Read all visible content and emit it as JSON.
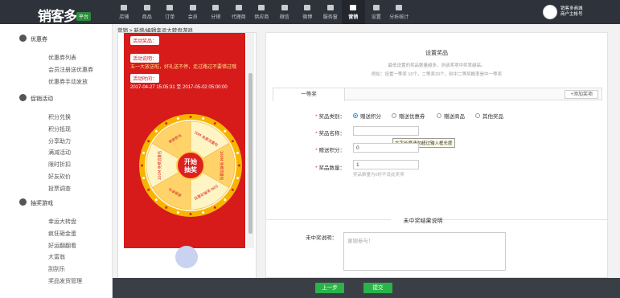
{
  "app": {
    "logo_text": "销客多",
    "logo_badge": "平台"
  },
  "nav": {
    "items": [
      {
        "label": "店铺",
        "icon": "store-icon"
      },
      {
        "label": "商品",
        "icon": "goods-icon"
      },
      {
        "label": "订单",
        "icon": "order-icon"
      },
      {
        "label": "会员",
        "icon": "member-icon"
      },
      {
        "label": "分销",
        "icon": "distribution-icon"
      },
      {
        "label": "代理商",
        "icon": "agent-icon"
      },
      {
        "label": "供应商",
        "icon": "supplier-icon"
      },
      {
        "label": "微信",
        "icon": "wechat-icon"
      },
      {
        "label": "微博",
        "icon": "weibo-icon"
      },
      {
        "label": "服务窗",
        "icon": "service-window-icon"
      },
      {
        "label": "营销",
        "icon": "marketing-icon"
      },
      {
        "label": "设置",
        "icon": "settings-icon"
      },
      {
        "label": "分析统计",
        "icon": "analytics-icon"
      }
    ],
    "active": "营销"
  },
  "user": {
    "line1": "销客多商城",
    "line2": "商户主帐号"
  },
  "sidebar": {
    "groups": [
      {
        "title": "优惠券",
        "items": [
          "优惠券列表",
          "会员注册送优惠券",
          "优惠券手动发放"
        ]
      },
      {
        "title": "促销活动",
        "items": [
          "积分兑换",
          "积分抵现",
          "分享助力",
          "满减活动",
          "限时折扣",
          "好友砍价",
          "投票调查"
        ]
      },
      {
        "title": "抽奖游戏",
        "items": [
          "幸运大转盘",
          "疯狂砸金蛋",
          "好运翻翻看",
          "大富翁",
          "刮刮乐",
          "奖品发货管理"
        ]
      }
    ]
  },
  "breadcrumb": "营销 > 新增/编辑幸运大转盘游戏",
  "preview": {
    "prize_tag": "活动奖品：",
    "desc_tag": "活动说明：",
    "desc_text": "五一大放送啦，好礼送不停，走过路过不要错过哦",
    "time_tag": "活动时间：",
    "time_text": "2017-04-27 15:05:31 至 2017-05-02 05:00:00",
    "wheel_center_top": "开始",
    "wheel_center_bottom": "抽奖",
    "wheel_segments": [
      "30M 免费流量包",
      "100M 免费流量包",
      "50M 免费流量包",
      "谢谢参与",
      "100M 免费流量包",
      "谢谢参与"
    ]
  },
  "settings": {
    "title": "设置奖品",
    "desc1": "最低设置的奖品数量越多，则该奖项中奖率越高。",
    "desc2": "例如：设置一等奖 10个，二等奖20个，则中二等奖概率是中一等奖",
    "tab_label": "一等奖",
    "add_award": "+添加奖项",
    "type_label": "奖品类别：",
    "type_options": [
      "赠送积分",
      "赠送优惠券",
      "赠送商品",
      "其他奖品"
    ],
    "type_selected": "赠送积分",
    "name_label": "奖品名称：",
    "name_value": "",
    "tooltip": "文字长度请勿超过输入框长度",
    "points_label": "赠送积分：",
    "points_value": "0",
    "qty_label": "奖品数量：",
    "qty_value": "1",
    "qty_hint": "奖品数量为0时不设此奖项",
    "no_win_title": "未中奖结果说明",
    "no_win_label": "未中奖说明：",
    "no_win_placeholder": "谢谢参与！"
  },
  "footer": {
    "prev": "上一步",
    "submit": "提交"
  }
}
